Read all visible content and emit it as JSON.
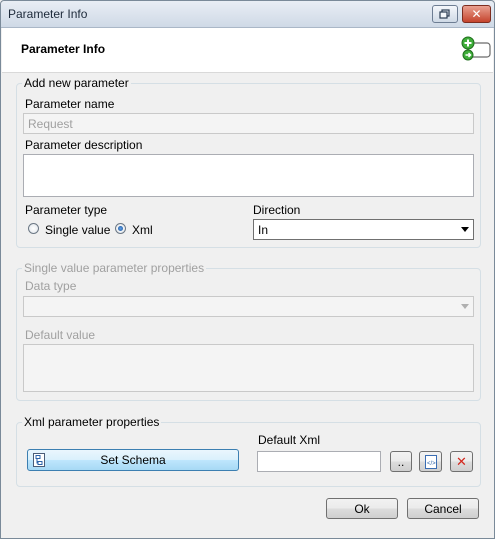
{
  "window": {
    "title": "Parameter Info"
  },
  "header": {
    "title": "Parameter Info",
    "icon": "add-parameter-icon"
  },
  "add_group": {
    "legend": "Add new parameter",
    "name_label": "Parameter name",
    "name_value": "Request",
    "description_label": "Parameter description",
    "description_value": "",
    "type_label": "Parameter type",
    "type_options": [
      "Single value",
      "Xml"
    ],
    "type_selected": "Xml",
    "direction_label": "Direction",
    "direction_value": "In"
  },
  "single_group": {
    "legend": "Single value parameter properties",
    "data_type_label": "Data type",
    "data_type_value": "",
    "default_value_label": "Default value",
    "default_value": ""
  },
  "xml_group": {
    "legend": "Xml parameter properties",
    "set_schema_label": "Set Schema",
    "default_xml_label": "Default Xml",
    "default_xml_value": "",
    "browse_label": ".."
  },
  "footer": {
    "ok_label": "Ok",
    "cancel_label": "Cancel"
  },
  "colors": {
    "accent": "#3c7fb1",
    "close_red": "#c5442d",
    "disabled_text": "#a0a0a0"
  }
}
